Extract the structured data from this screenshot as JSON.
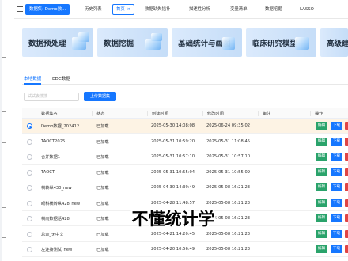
{
  "tabbar": {
    "tabs": [
      {
        "label": "数据集: Demo数...",
        "style": "data"
      },
      {
        "label": "历史列表",
        "style": "plain"
      },
      {
        "label": "首页",
        "style": "active"
      },
      {
        "label": "数据缺失插补",
        "style": "plain"
      },
      {
        "label": "描述性分析",
        "style": "plain"
      },
      {
        "label": "变量清单",
        "style": "plain"
      },
      {
        "label": "数据挖掘",
        "style": "plain"
      },
      {
        "label": "LASSO",
        "style": "plain"
      }
    ],
    "close_glyph": "×"
  },
  "cards": [
    {
      "label": "数据预处理"
    },
    {
      "label": "数据挖掘"
    },
    {
      "label": "基础统计与画图"
    },
    {
      "label": "临床研究模型"
    },
    {
      "label": "高级建"
    }
  ],
  "subtabs": [
    {
      "label": "本地数据",
      "active": true
    },
    {
      "label": "EDC数据",
      "active": false
    }
  ],
  "search": {
    "placeholder": "试试去搜搜"
  },
  "upload_label": "上传数据集",
  "table": {
    "headers": {
      "name": "数据集名",
      "status": "状态",
      "created": "创建时间",
      "modified": "修改时间",
      "note": "备注",
      "ops": "操作"
    },
    "rows": [
      {
        "name": "Demo数据_202412",
        "status": "已加载",
        "created": "2025-05-30 14:08:08",
        "modified": "2025-06-24 09:35:02",
        "selected": true
      },
      {
        "name": "TAOCT2025",
        "status": "已加载",
        "created": "2025-05-31 10:59:20",
        "modified": "2025-05-31 11:08:45",
        "selected": false
      },
      {
        "name": "合并数据1",
        "status": "已加载",
        "created": "2025-05-31 10:57:10",
        "modified": "2025-05-31 10:57:10",
        "selected": false
      },
      {
        "name": "TAOCT",
        "status": "已加载",
        "created": "2025-05-31 10:55:04",
        "modified": "2025-05-31 10:55:09",
        "selected": false
      },
      {
        "name": "横转纵430_new",
        "status": "已加载",
        "created": "2025-04-30 14:39:49",
        "modified": "2025-05-08 16:21:23",
        "selected": false
      },
      {
        "name": "眼科横转纵428_new",
        "status": "已加载",
        "created": "2025-04-28 11:48:57",
        "modified": "2025-05-08 16:21:23",
        "selected": false
      },
      {
        "name": "横向数据话428",
        "status": "已加载",
        "created": "2025-04-28 11:05:34",
        "modified": "2025-05-08 16:21:23",
        "selected": false
      },
      {
        "name": "总表_无中文",
        "status": "已加载",
        "created": "2025-04-21 14:20:45",
        "modified": "2025-05-08 16:21:23",
        "selected": false
      },
      {
        "name": "左连接测试_new",
        "status": "已加载",
        "created": "2025-04-20 10:56:49",
        "modified": "2025-05-08 16:21:23",
        "selected": false
      }
    ],
    "edit_label": "编辑",
    "download_label": "下载"
  },
  "subtitle": "不懂统计学",
  "colors": {
    "accent": "#1677ff",
    "edit": "#2aa36b",
    "selected_row": "#fdf3e4",
    "delete": "#e04545"
  }
}
